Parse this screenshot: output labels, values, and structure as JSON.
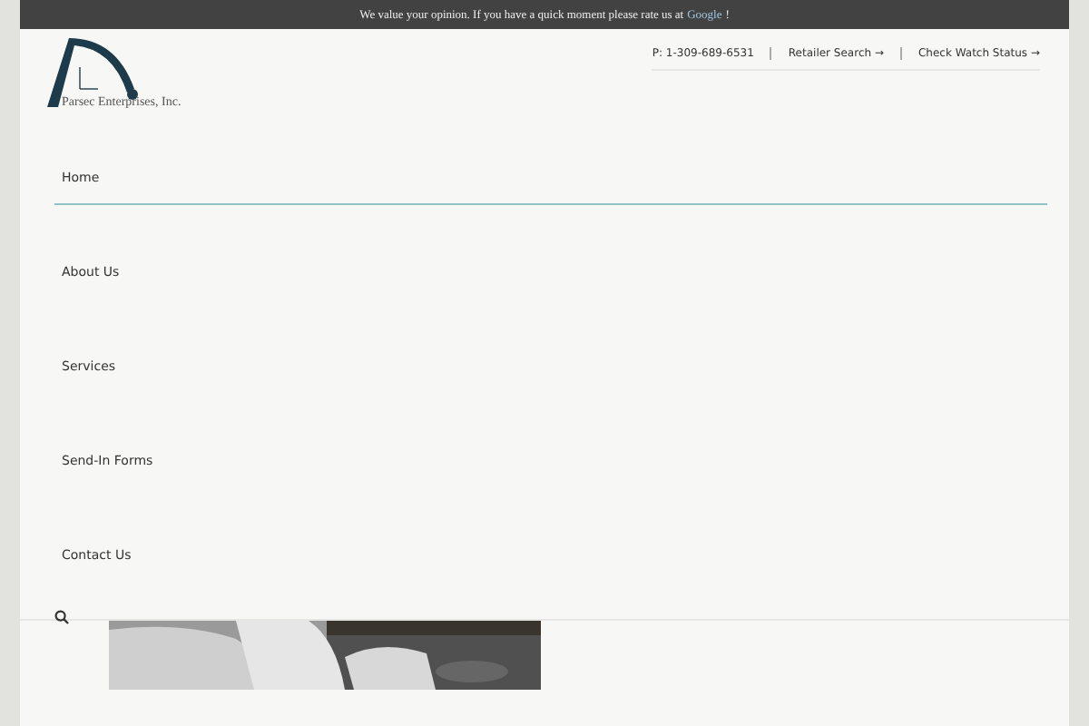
{
  "top_bar": {
    "message": "We value your opinion. If you have a quick moment please rate us at",
    "link": "Google",
    "suffix": "!"
  },
  "logo": {
    "name": "Parsec Enterprises, Inc."
  },
  "contact": {
    "phone": "P: 1-309-689-6531",
    "links": [
      {
        "label": "Retailer Search →"
      },
      {
        "label": "Check Watch Status →"
      }
    ]
  },
  "nav": [
    {
      "label": "Home",
      "selected": true
    },
    {
      "label": "About Us",
      "selected": false
    },
    {
      "label": "Services",
      "selected": false
    },
    {
      "label": "Send-In Forms",
      "selected": false
    },
    {
      "label": "Contact Us",
      "selected": false
    }
  ]
}
